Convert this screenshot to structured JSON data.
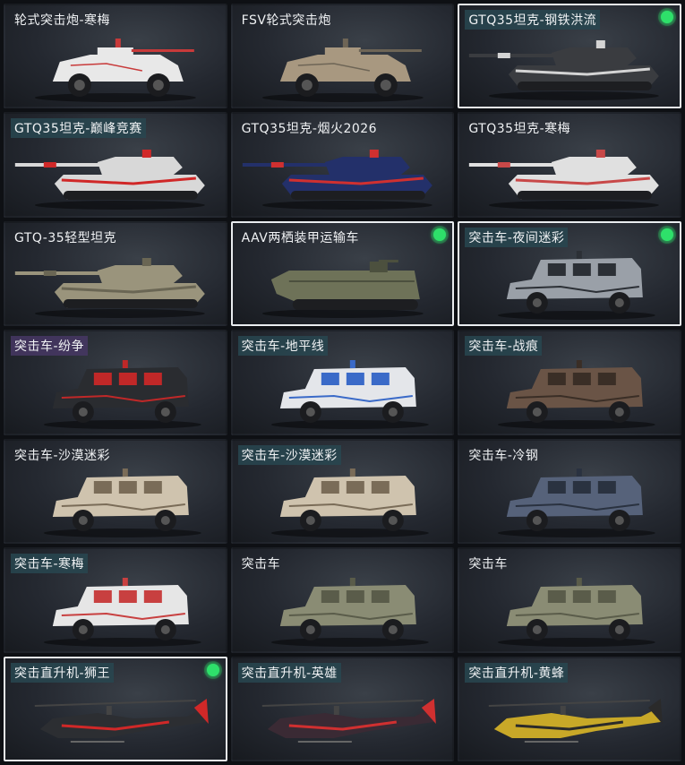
{
  "cards": [
    {
      "label": "轮式突击炮-寒梅",
      "type": "wheeled",
      "body": "#e8e8e8",
      "accent": "#c83a3a",
      "tag": "plain",
      "selected": false,
      "dot": false
    },
    {
      "label": "FSV轮式突击炮",
      "type": "wheeled",
      "body": "#a89880",
      "accent": "#6e6556",
      "tag": "plain",
      "selected": false,
      "dot": false
    },
    {
      "label": "GTQ35坦克-钢铁洪流",
      "type": "tank",
      "body": "#3a3c40",
      "accent": "#d4d4d4",
      "tag": "teal",
      "selected": true,
      "dot": true
    },
    {
      "label": "GTQ35坦克-巅峰竞赛",
      "type": "tank",
      "body": "#d8d8d8",
      "accent": "#d02828",
      "tag": "teal",
      "selected": false,
      "dot": false
    },
    {
      "label": "GTQ35坦克-烟火2026",
      "type": "tank",
      "body": "#23306a",
      "accent": "#d03030",
      "tag": "plain",
      "selected": false,
      "dot": false
    },
    {
      "label": "GTQ35坦克-寒梅",
      "type": "tank",
      "body": "#e0e0e0",
      "accent": "#c84848",
      "tag": "plain",
      "selected": false,
      "dot": false
    },
    {
      "label": "GTQ-35轻型坦克",
      "type": "tank",
      "body": "#9a947c",
      "accent": "#6a6654",
      "tag": "plain",
      "selected": false,
      "dot": false
    },
    {
      "label": "AAV两栖装甲运输车",
      "type": "aav",
      "body": "#6e7258",
      "accent": "#4c503e",
      "tag": "plain",
      "selected": true,
      "dot": true
    },
    {
      "label": "突击车-夜间迷彩",
      "type": "truck",
      "body": "#9aa0a8",
      "accent": "#2c3036",
      "tag": "teal",
      "selected": true,
      "dot": true
    },
    {
      "label": "突击车-纷争",
      "type": "truck",
      "body": "#2a2c30",
      "accent": "#c02828",
      "tag": "purple",
      "selected": false,
      "dot": false
    },
    {
      "label": "突击车-地平线",
      "type": "truck",
      "body": "#e4e6ea",
      "accent": "#3a6ac8",
      "tag": "teal",
      "selected": false,
      "dot": false
    },
    {
      "label": "突击车-战痕",
      "type": "truck",
      "body": "#6a5446",
      "accent": "#3a2e26",
      "tag": "teal",
      "selected": false,
      "dot": false
    },
    {
      "label": "突击车-沙漠迷彩",
      "type": "truck",
      "body": "#cfc3ae",
      "accent": "#7a6c58",
      "tag": "plain",
      "selected": false,
      "dot": false
    },
    {
      "label": "突击车-沙漠迷彩",
      "type": "truck",
      "body": "#cfc3ae",
      "accent": "#7a6c58",
      "tag": "teal",
      "selected": false,
      "dot": false
    },
    {
      "label": "突击车-冷钢",
      "type": "truck",
      "body": "#56627a",
      "accent": "#2a3240",
      "tag": "plain",
      "selected": false,
      "dot": false
    },
    {
      "label": "突击车-寒梅",
      "type": "truck",
      "body": "#e6e6e6",
      "accent": "#c84040",
      "tag": "teal",
      "selected": false,
      "dot": false
    },
    {
      "label": "突击车",
      "type": "truck",
      "body": "#8a8c74",
      "accent": "#5a5c4a",
      "tag": "plain",
      "selected": false,
      "dot": false
    },
    {
      "label": "突击车",
      "type": "truck",
      "body": "#8a8c74",
      "accent": "#5a5c4a",
      "tag": "plain",
      "selected": false,
      "dot": false
    },
    {
      "label": "突击直升机-狮王",
      "type": "heli",
      "body": "#2c2e32",
      "accent": "#d02828",
      "tag": "teal",
      "selected": true,
      "dot": true
    },
    {
      "label": "突击直升机-英雄",
      "type": "heli",
      "body": "#3a2a34",
      "accent": "#d03030",
      "tag": "teal",
      "selected": false,
      "dot": false
    },
    {
      "label": "突击直升机-黄蜂",
      "type": "heli",
      "body": "#c8a828",
      "accent": "#2a2a2a",
      "tag": "teal",
      "selected": false,
      "dot": false
    }
  ]
}
